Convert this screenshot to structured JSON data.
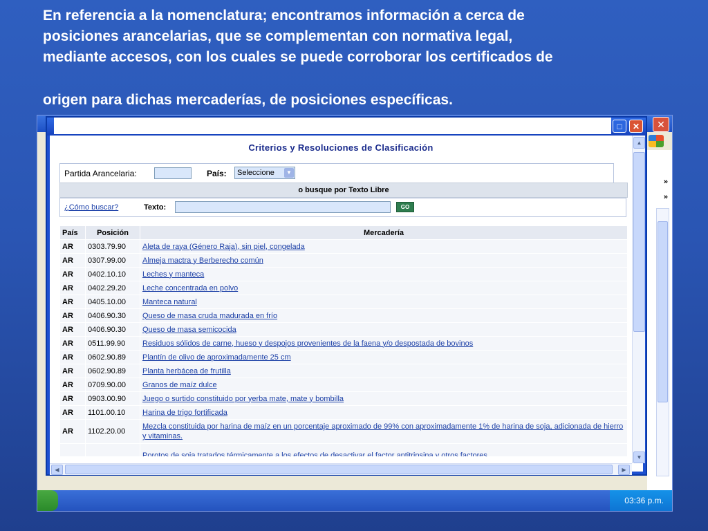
{
  "slide": {
    "lines": [
      "En referencia a la nomenclatura; encontramos información a cerca de",
      "posiciones arancelarias, que se complementan con normativa legal,",
      "mediante accesos, con los cuales se puede corroborar los certificados de",
      "origen para dichas mercaderías, de posiciones específicas."
    ]
  },
  "back_window": {
    "chevron": "»",
    "clock": "03:36 p.m."
  },
  "main_window": {
    "max_glyph": "□",
    "close_glyph": "✕"
  },
  "page": {
    "title": "Criterios y Resoluciones de Clasificación",
    "partida_label": "Partida Arancelaria:",
    "pais_label": "País:",
    "pais_value": "Seleccione",
    "busque_label": "o busque por Texto Libre",
    "como_link": "¿Cómo buscar?",
    "texto_label": "Texto:",
    "go_label": "GO"
  },
  "table": {
    "headers": [
      "País",
      "Posición",
      "Mercadería"
    ],
    "rows": [
      {
        "pais": "AR",
        "pos": "0303.79.90",
        "merc": "Aleta de raya (Género Raja), sin piel, congelada"
      },
      {
        "pais": "AR",
        "pos": "0307.99.00",
        "merc": "Almeja mactra y Berberecho común"
      },
      {
        "pais": "AR",
        "pos": "0402.10.10",
        "merc": "Leches y manteca"
      },
      {
        "pais": "AR",
        "pos": "0402.29.20",
        "merc": "Leche concentrada en polvo"
      },
      {
        "pais": "AR",
        "pos": "0405.10.00",
        "merc": "Manteca natural"
      },
      {
        "pais": "AR",
        "pos": "0406.90.30",
        "merc": "Queso de masa cruda madurada en frío"
      },
      {
        "pais": "AR",
        "pos": "0406.90.30",
        "merc": "Queso de masa semicocida"
      },
      {
        "pais": "AR",
        "pos": "0511.99.90",
        "merc": "Residuos sólidos de carne, hueso y despojos provenientes de la faena y/o despostada de bovinos"
      },
      {
        "pais": "AR",
        "pos": "0602.90.89",
        "merc": "Plantín de olivo de aproximadamente 25 cm"
      },
      {
        "pais": "AR",
        "pos": "0602.90.89",
        "merc": "Planta herbácea de frutilla"
      },
      {
        "pais": "AR",
        "pos": "0709.90.00",
        "merc": "Granos de maíz dulce"
      },
      {
        "pais": "AR",
        "pos": "0903.00.90",
        "merc": "Juego o surtido constituido por yerba mate, mate y bombilla"
      },
      {
        "pais": "AR",
        "pos": "1101.00.10",
        "merc": "Harina de trigo fortificada"
      },
      {
        "pais": "AR",
        "pos": "1102.20.00",
        "merc": "Mezcla constituida por harina de maíz en un porcentaje aproximado de 99% con aproximadamente 1% de harina de soja, adicionada de hierro y vitaminas."
      },
      {
        "pais": "",
        "pos": "",
        "merc": "Porotos de soja tratados térmicamente a los efectos de desactivar el factor antitripsina y otros factores"
      }
    ]
  },
  "colors": {
    "slide_bg": "#2a55b3",
    "link": "#1b3fa6",
    "title": "#1a2b8c"
  }
}
